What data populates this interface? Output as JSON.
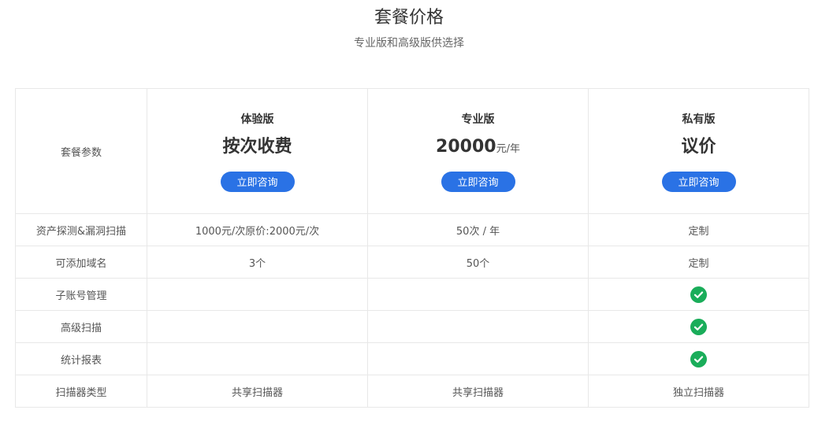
{
  "header": {
    "title": "套餐价格",
    "subtitle": "专业版和高级版供选择"
  },
  "table": {
    "param_header": "套餐参数",
    "plans": [
      {
        "name": "体验版",
        "price": "按次收费",
        "unit": "",
        "button": "立即咨询"
      },
      {
        "name": "专业版",
        "price": "20000",
        "unit": "元/年",
        "button": "立即咨询"
      },
      {
        "name": "私有版",
        "price": "议价",
        "unit": "",
        "button": "立即咨询"
      }
    ],
    "rows": [
      {
        "label": "资产探测&漏洞扫描",
        "values": [
          "1000元/次原价:2000元/次",
          "50次 / 年",
          "定制"
        ]
      },
      {
        "label": "可添加域名",
        "values": [
          "3个",
          "50个",
          "定制"
        ]
      },
      {
        "label": "子账号管理",
        "values": [
          "",
          "",
          "check"
        ]
      },
      {
        "label": "高级扫描",
        "values": [
          "",
          "",
          "check"
        ]
      },
      {
        "label": "统计报表",
        "values": [
          "",
          "",
          "check"
        ]
      },
      {
        "label": "扫描器类型",
        "values": [
          "共享扫描器",
          "共享扫描器",
          "独立扫描器"
        ]
      }
    ]
  },
  "icons": {
    "included": "check-circle-icon"
  },
  "colors": {
    "button": "#2a72e5",
    "check": "#1aad5a"
  }
}
